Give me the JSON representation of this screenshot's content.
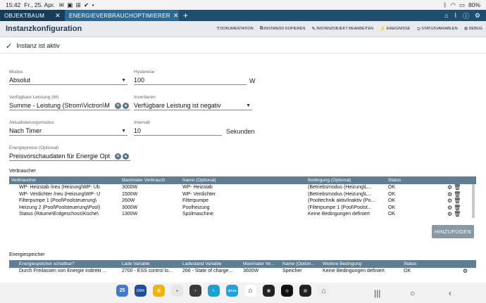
{
  "statusbar": {
    "time": "15:42",
    "date": "Fr., 25. Apr.",
    "left_icons": "✉ ▣ ⊞ ✔ •",
    "battery": "80%"
  },
  "tabs": [
    {
      "label": "OBJEKTBAUM",
      "close": "✕"
    },
    {
      "label": "ENERGIEVERBRAUCHOPTIMIERER",
      "close": "✕"
    }
  ],
  "tab_plus": "+",
  "header": {
    "title": "Instanzkonfiguration",
    "actions": [
      {
        "icon": "?",
        "label": "DOKUMENTATION"
      },
      {
        "icon": "⧉",
        "label": "INSTANZID KOPIEREN"
      },
      {
        "icon": "✎",
        "label": "INSTANZOBJEKT BEARBEITEN"
      },
      {
        "icon": "⚡",
        "label": "EREIGNISSE"
      },
      {
        "icon": "⊃",
        "label": "STATUSVARIABLEN"
      },
      {
        "icon": "✲",
        "label": "DEBUG"
      }
    ]
  },
  "active": {
    "label": "Instanz ist aktiv"
  },
  "form": {
    "modus": {
      "label": "Modus",
      "value": "Absolut"
    },
    "hysterese": {
      "label": "Hysterese",
      "value": "100",
      "unit": "W"
    },
    "leistung": {
      "label": "Verfügbare Leistung (W)",
      "value": "Summe - Leistung (Strom\\Victron\\M"
    },
    "invertieren": {
      "label": "Invertieren",
      "value": "Verfügbare Leistung ist negativ"
    },
    "aktualisierung": {
      "label": "Aktualisierungsmodus",
      "value": "Nach Timer"
    },
    "intervall": {
      "label": "Intervall",
      "value": "10",
      "unit": "Sekunden"
    },
    "energiepreise": {
      "label": "Energiepreise (Optional)",
      "value": "Preisvorschaudaten für Energie Opt"
    }
  },
  "verbraucher": {
    "title": "Verbraucher",
    "columns": [
      "Verbraucher",
      "Maximaler Verbrauch",
      "Name (Optional)",
      "Bedingung (Optional)",
      "Status"
    ],
    "rows": [
      [
        "WP- Heizstab /neu (Heizung\\WP- Üb",
        "3000W",
        "WP- Heizstab",
        "(Betriebsmodus (Heizung\\L...",
        "OK"
      ],
      [
        "WP- Verdichter /neu (Heizung\\WP- Ü",
        "1500W",
        "WP- Verdichter",
        "(Betriebsmodus (Heizung\\L...",
        "OK"
      ],
      [
        "Filterpumpe 1 (Pool\\Poolsteuerung\\",
        "260W",
        "Filterpumpe",
        "(Pooltechnik aktiv/inaktiv (Po...",
        "OK"
      ],
      [
        "Heizung 2 (Pool\\Poolsteuerung\\Pool)",
        "3000W",
        "Poolheizung",
        "(Filterpumpe 1 (Pool\\Poolst...",
        "OK"
      ],
      [
        "Status (Räume\\Erdgeschoss\\Küche\\",
        "1300W",
        "Spülmaschine",
        "Keine Bedingungen definiert",
        "OK"
      ]
    ],
    "add_label": "HINZUFÜGEN"
  },
  "energiespeicher": {
    "title": "Energiespeicher",
    "columns": [
      "Energiespeicher schaltbar?",
      "Lade Variable",
      "Ladestand Variable",
      "Maximaler Ve...",
      "Name (Option...",
      "Weitere Bedingung",
      "Status"
    ],
    "rows": [
      [
        "Durch Freilassen von Energie indirekt ...",
        "2700 - ESS control lo...",
        "266 - State of charge...",
        "3600W",
        "Speicher",
        "Keine Bedingungen definiert",
        "OK"
      ]
    ]
  },
  "dock": {
    "calendar_day": "25",
    "apps": [
      {
        "label": "",
        "color": "#e33"
      },
      {
        "label": "GMX",
        "color": "#1c4f9c"
      },
      {
        "label": "",
        "color": "#f2b400"
      },
      {
        "label": "",
        "color": "#e7e7e7"
      },
      {
        "label": "",
        "color": "#3a3a3a"
      },
      {
        "label": "",
        "color": "#17a2d6"
      },
      {
        "label": "alexa",
        "color": "#1aa3e8"
      },
      {
        "label": "",
        "color": "#ffffff"
      },
      {
        "label": "",
        "color": "#222"
      },
      {
        "label": "",
        "color": "#111"
      },
      {
        "label": "",
        "color": "#222"
      }
    ]
  }
}
